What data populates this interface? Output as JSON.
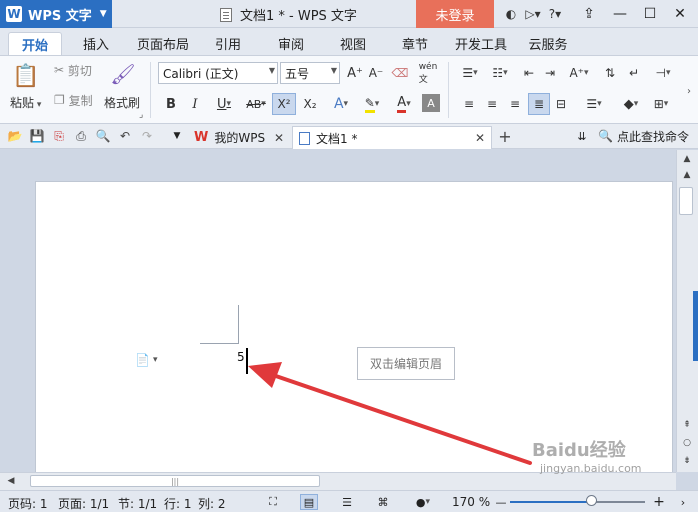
{
  "titlebar": {
    "app_name": "WPS 文字",
    "doc_title": "文档1 * - WPS 文字",
    "login_label": "未登录",
    "icons": [
      "skin-icon",
      "comment-icon",
      "help-icon",
      "ribbon-toggle-icon",
      "minimize-icon",
      "maximize-icon",
      "close-icon"
    ]
  },
  "menu": {
    "tabs": [
      "开始",
      "插入",
      "页面布局",
      "引用",
      "审阅",
      "视图",
      "章节",
      "开发工具",
      "云服务"
    ],
    "active": "开始"
  },
  "ribbon": {
    "paste_label": "粘贴",
    "cut_label": "剪切",
    "copy_label": "复制",
    "format_painter_label": "格式刷",
    "font_name": "Calibri (正文)",
    "font_size": "五号"
  },
  "quick_bar": {
    "tabs": [
      {
        "label": "我的WPS"
      },
      {
        "label": "文档1 *"
      }
    ],
    "search_label": "点此查找命令"
  },
  "document": {
    "typed_text": "5",
    "header_hint": "双击编辑页眉"
  },
  "status": {
    "page": "页码: 1",
    "pages": "页面: 1/1",
    "section": "节: 1/1",
    "row": "行: 1",
    "col": "列: 2",
    "zoom": "170 %"
  },
  "watermark": {
    "brand": "Baidu经验",
    "url": "jingyan.baidu.com"
  },
  "colors": {
    "accent": "#2b6fc2",
    "login_bg": "#e8705a",
    "arrow": "#e0393b"
  }
}
